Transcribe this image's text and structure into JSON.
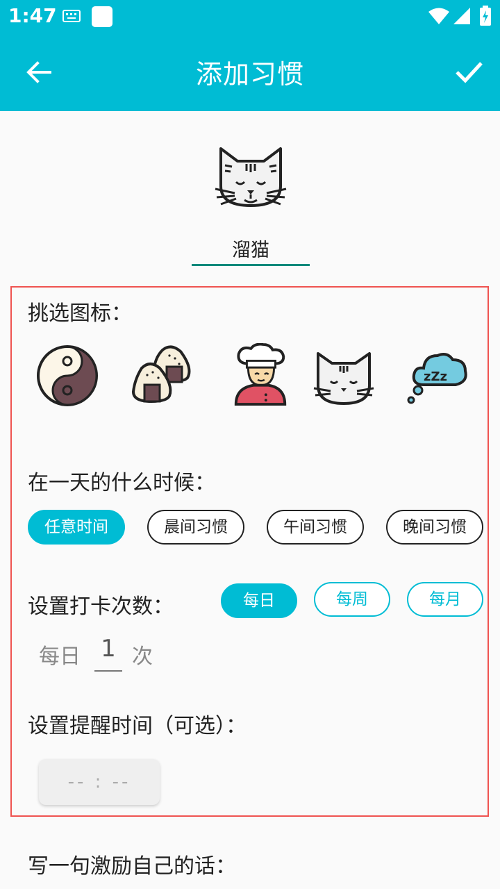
{
  "status_bar": {
    "time": "1:47"
  },
  "app_bar": {
    "title": "添加习惯"
  },
  "habit": {
    "name": "溜猫"
  },
  "icon_picker": {
    "label": "挑选图标：",
    "icons": [
      "yin-yang-icon",
      "rice-ball-icon",
      "chef-icon",
      "cat-icon",
      "sleep-cloud-icon"
    ]
  },
  "time_of_day": {
    "label": "在一天的什么时候：",
    "options": [
      "任意时间",
      "晨间习惯",
      "午间习惯",
      "晚间习惯"
    ],
    "selected": "任意时间"
  },
  "checkin": {
    "label": "设置打卡次数：",
    "periods": [
      "每日",
      "每周",
      "每月"
    ],
    "selected": "每日",
    "prefix": "每日",
    "count": "1",
    "suffix": "次"
  },
  "reminder": {
    "label": "设置提醒时间（可选）：",
    "time_placeholder": "-- : --"
  },
  "motivation": {
    "label": "写一句激励自己的话："
  },
  "colors": {
    "primary": "#00bcd4",
    "highlight_border": "#ef5350",
    "underline": "#00897b"
  }
}
